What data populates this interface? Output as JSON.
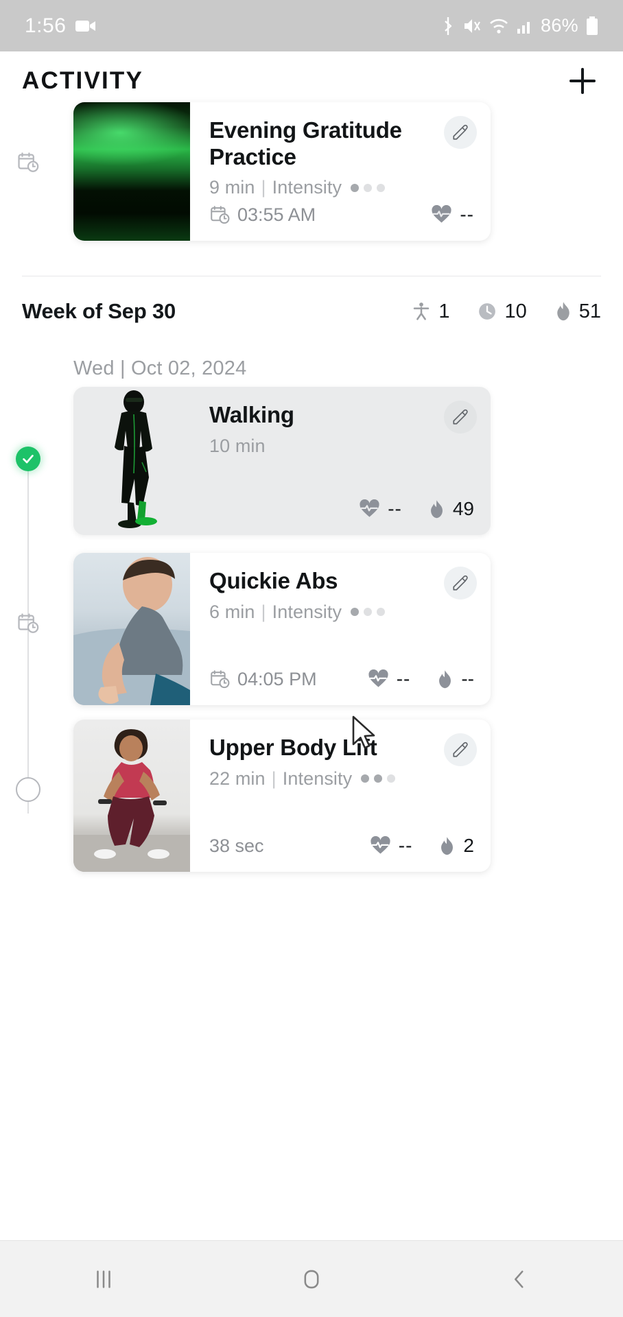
{
  "status_bar": {
    "time": "1:56",
    "battery_percent": "86%",
    "icons": [
      "video-camera-icon",
      "bluetooth-icon",
      "mute-icon",
      "wifi-icon",
      "cellular-signal-icon",
      "battery-icon"
    ]
  },
  "header": {
    "title": "ACTIVITY",
    "add_label": "+"
  },
  "top_card": {
    "title": "Evening Gratitude Practice",
    "duration": "9 min",
    "separator": "|",
    "intensity_label": "Intensity",
    "intensity_level": 1,
    "intensity_max": 3,
    "scheduled_time": "03:55 AM",
    "heart_rate": "--",
    "marker": "calendar-clock"
  },
  "week_summary": {
    "title": "Week of Sep 30",
    "workouts": "1",
    "minutes": "10",
    "calories": "51"
  },
  "day_group": {
    "date_label": "Wed | Oct 02, 2024"
  },
  "cards": [
    {
      "title": "Walking",
      "duration": "10 min",
      "has_intensity": false,
      "intensity_label": "",
      "intensity_level": 0,
      "intensity_max": 3,
      "foot_left": "",
      "heart_rate": "--",
      "calories": "49",
      "show_calories": true,
      "marker": "check",
      "state": "completed"
    },
    {
      "title": "Quickie Abs",
      "duration": "6 min",
      "has_intensity": true,
      "intensity_label": "Intensity",
      "intensity_level": 1,
      "intensity_max": 3,
      "foot_left": "04:05 PM",
      "heart_rate": "--",
      "calories": "--",
      "show_calories": true,
      "marker": "calendar-clock",
      "state": "scheduled"
    },
    {
      "title": "Upper Body Lift",
      "duration": "22 min",
      "has_intensity": true,
      "intensity_label": "Intensity",
      "intensity_level": 2,
      "intensity_max": 3,
      "foot_left": "38 sec",
      "heart_rate": "--",
      "calories": "2",
      "show_calories": true,
      "marker": "hollow",
      "state": "in-progress"
    }
  ],
  "nav_bar": {
    "recents": "recents-icon",
    "home": "home-icon",
    "back": "back-icon"
  },
  "colors": {
    "accent_green": "#1dc268",
    "status_bar_bg": "#c9c9c9",
    "card_shaded": "#eaebec",
    "muted_text": "#9b9ea2"
  }
}
